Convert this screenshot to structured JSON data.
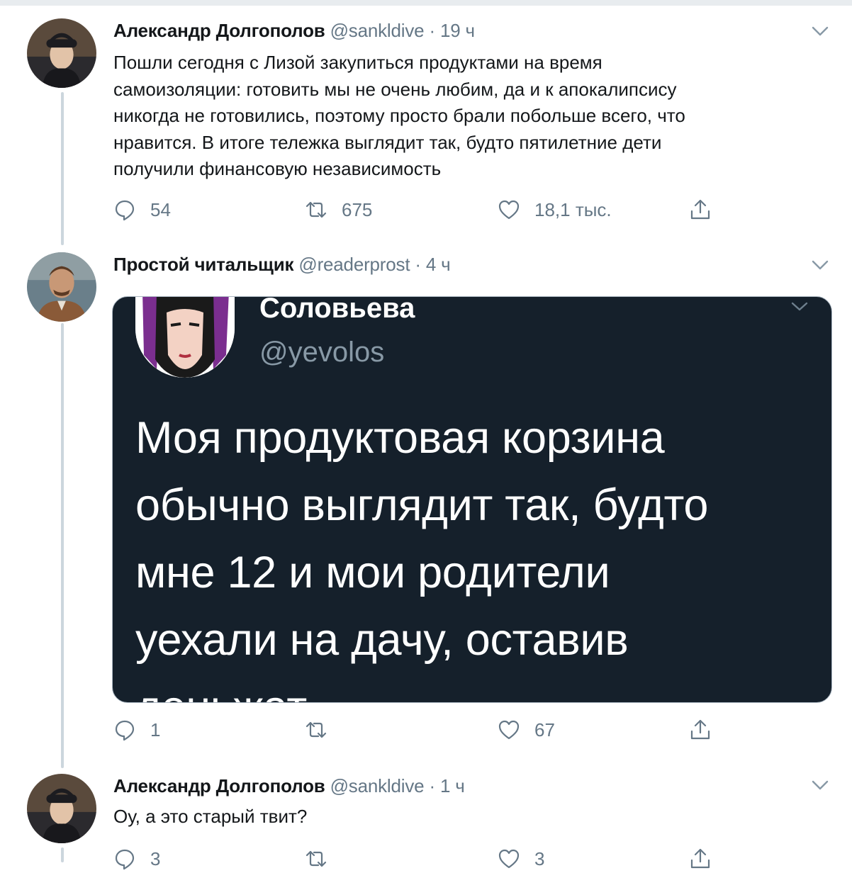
{
  "tweets": [
    {
      "author": "Александр Долгополов",
      "handle": "@sankldive",
      "dot": "·",
      "time": "19 ч",
      "text_lines": [
        "Пошли сегодня с Лизой закупиться продуктами на время",
        "самоизоляции: готовить мы не очень любим, да и к апокалипсису",
        "никогда не готовились, поэтому просто брали побольше всего, что",
        "нравится. В итоге тележка выглядит так, будто пятилетние дети",
        "получили финансовую независимость"
      ],
      "replies": "54",
      "retweets": "675",
      "likes": "18,1 тыс."
    },
    {
      "author": "Простой читальщик",
      "handle": "@readerprost",
      "dot": "·",
      "time": "4 ч",
      "replies": "1",
      "retweets": "",
      "likes": "67",
      "embed": {
        "name": "Соловьева",
        "handle": "@yevolos",
        "text_lines": [
          "Моя продуктовая корзина",
          "обычно выглядит так, будто",
          "мне 12 и мои родители",
          "уехали на дачу, оставив",
          "деньжат"
        ]
      }
    },
    {
      "author": "Александр Долгополов",
      "handle": "@sankldive",
      "dot": "·",
      "time": "1 ч",
      "text": "Оу, а это старый твит?",
      "replies": "3",
      "retweets": "",
      "likes": "3"
    }
  ],
  "icons": {
    "reply": "reply-icon",
    "retweet": "retweet-icon",
    "like": "heart-icon",
    "share": "share-icon",
    "more": "chevron-down-icon"
  },
  "colors": {
    "text": "#14171a",
    "secondary": "#657786",
    "thread_line": "#ccd6dd",
    "embed_bg": "#15202b"
  }
}
